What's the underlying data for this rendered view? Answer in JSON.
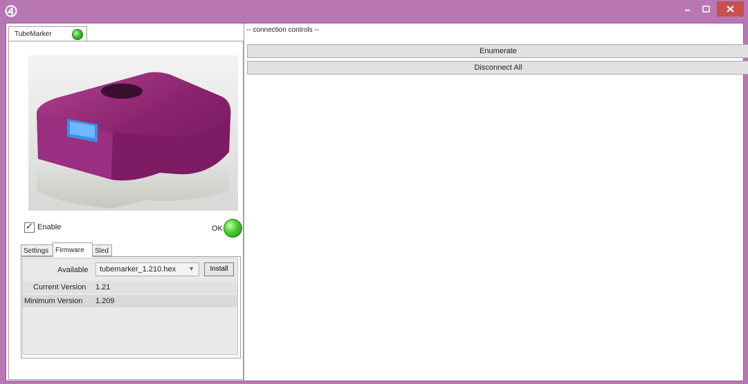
{
  "window": {
    "accent": "#b877b3",
    "close_color": "#c75050"
  },
  "device": {
    "tab_label": "TubeMarker",
    "status_led": "green",
    "enable_label": "Enable",
    "enabled": true,
    "status_text": "OK"
  },
  "subtabs": [
    "Settings",
    "Firmware",
    "Sled"
  ],
  "active_subtab": "Firmware",
  "firmware": {
    "available_label": "Available",
    "selected_file": "tubemarker_1.210.hex",
    "install_label": "Install",
    "current_version_label": "Current Version",
    "current_version": "1.21",
    "minimum_version_label": "Minimum Version",
    "minimum_version": "1.209"
  },
  "connection": {
    "header": "-- connection controls --",
    "enumerate_label": "Enumerate",
    "disconnect_label": "Disconnect All"
  }
}
